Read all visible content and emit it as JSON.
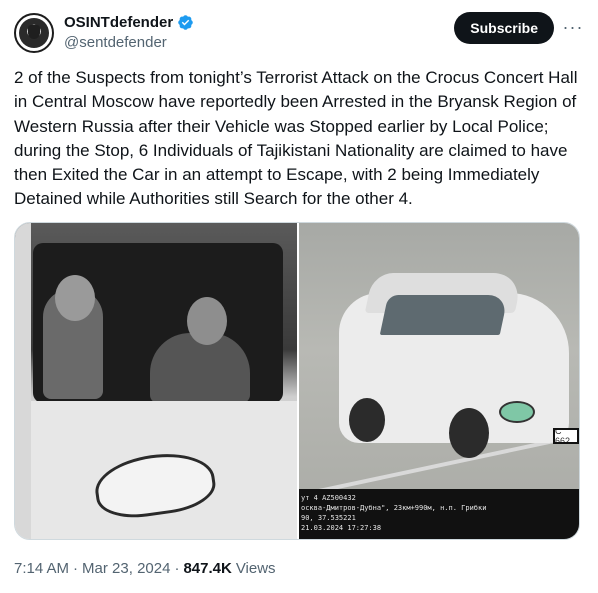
{
  "author": {
    "display_name": "OSINTdefender",
    "handle": "@sentdefender",
    "verified_icon": "verified-badge-icon",
    "verified_color": "#1d9bf0"
  },
  "actions": {
    "subscribe_label": "Subscribe",
    "more_icon": "more-horizontal-icon"
  },
  "tweet": {
    "text": "2 of the Suspects from tonight’s Terrorist Attack on the Crocus Concert Hall in Central Moscow have reportedly been Arrested in the Bryansk Region of Western Russia after their Vehicle was Stopped earlier by Local Police; during the Stop, 6 Individuals of Tajikistani Nationality are claimed to have then Exited the Car in an attempt to Escape, with 2 being Immediately Detained while Authorities still Search for the other 4."
  },
  "media": {
    "right_photo": {
      "plate_text": "С 662",
      "overlay_lines": [
        "ут 4 AZ500432",
        "осква-Дмитров-Дубна\", 23км+990м, н.п. Грибки",
        "",
        "90, 37.535221",
        "21.03.2024 17:27:38"
      ]
    }
  },
  "meta": {
    "time": "7:14 AM",
    "separator": "·",
    "date": "Mar 23, 2024",
    "separator2": "·",
    "views_count": "847.4K",
    "views_label": "Views"
  }
}
